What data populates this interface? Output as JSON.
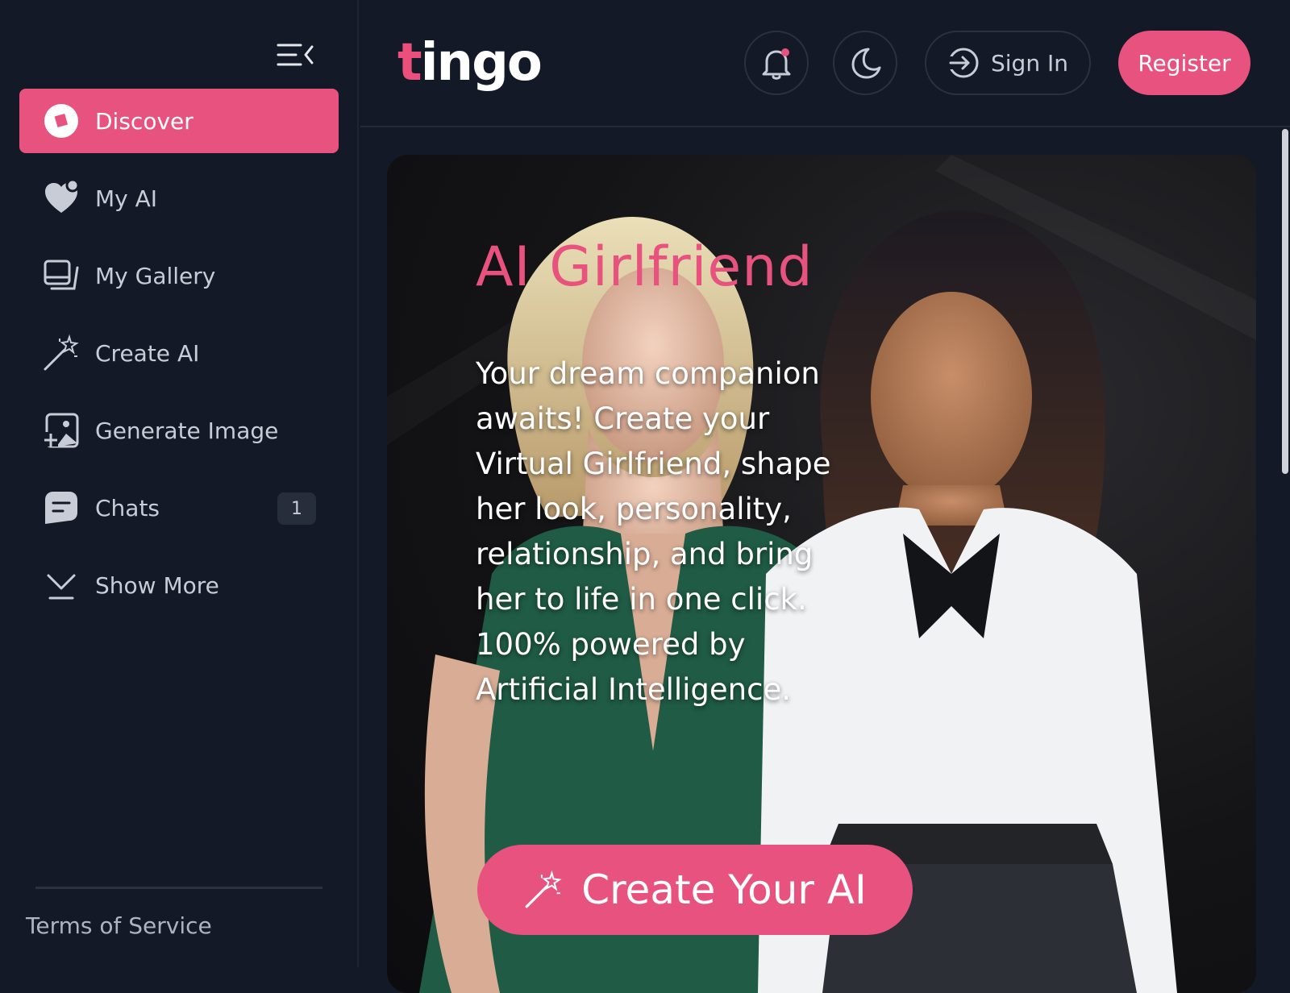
{
  "logo": {
    "accent_letter": "t",
    "rest": "ingo"
  },
  "sidebar": {
    "items": [
      {
        "label": "Discover",
        "icon": "compass-icon",
        "active": true
      },
      {
        "label": "My AI",
        "icon": "heart-icon"
      },
      {
        "label": "My Gallery",
        "icon": "gallery-icon"
      },
      {
        "label": "Create AI",
        "icon": "magic-wand-icon"
      },
      {
        "label": "Generate Image",
        "icon": "image-add-icon"
      },
      {
        "label": "Chats",
        "icon": "chat-icon",
        "badge": "1"
      },
      {
        "label": "Show More",
        "icon": "chevron-down-icon"
      }
    ],
    "footer_link": "Terms of Service"
  },
  "header": {
    "sign_in_label": "Sign In",
    "register_label": "Register"
  },
  "hero": {
    "title": "AI Girlfriend",
    "description": "Your dream companion awaits! Create your Virtual Girlfriend, shape her look, personality, relationship, and bring her to life in one click. 100% powered by Artificial Intelligence.",
    "cta_label": "Create Your AI"
  },
  "colors": {
    "accent": "#e8527e",
    "background": "#131926",
    "text": "#c8ccd6"
  }
}
